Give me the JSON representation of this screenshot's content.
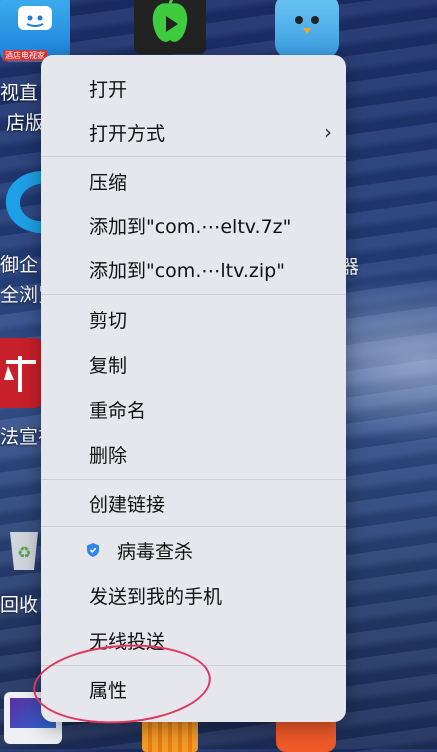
{
  "desktop": {
    "labels": {
      "tv_line1": "视直",
      "tv_line2": "店版",
      "browser_line1": "御企",
      "browser_line2": "全浏览",
      "law": "法宣在",
      "recycle": "回收",
      "right_label_1": "器"
    },
    "tv_icon_caption": "酒店电视家"
  },
  "context_menu": {
    "items": [
      {
        "label": "打开"
      },
      {
        "label": "打开方式",
        "has_submenu": true
      },
      {
        "label": "压缩"
      },
      {
        "label": "添加到\"com.⋯eltv.7z\""
      },
      {
        "label": "添加到\"com.⋯ltv.zip\""
      },
      {
        "label": "剪切"
      },
      {
        "label": "复制"
      },
      {
        "label": "重命名"
      },
      {
        "label": "删除"
      },
      {
        "label": "创建链接"
      },
      {
        "label": "病毒查杀",
        "icon": "shield-icon"
      },
      {
        "label": "发送到我的手机"
      },
      {
        "label": "无线投送"
      },
      {
        "label": "属性"
      }
    ],
    "submenu_chevron": "›"
  },
  "annotation": {
    "highlight_color": "#e0365d"
  }
}
